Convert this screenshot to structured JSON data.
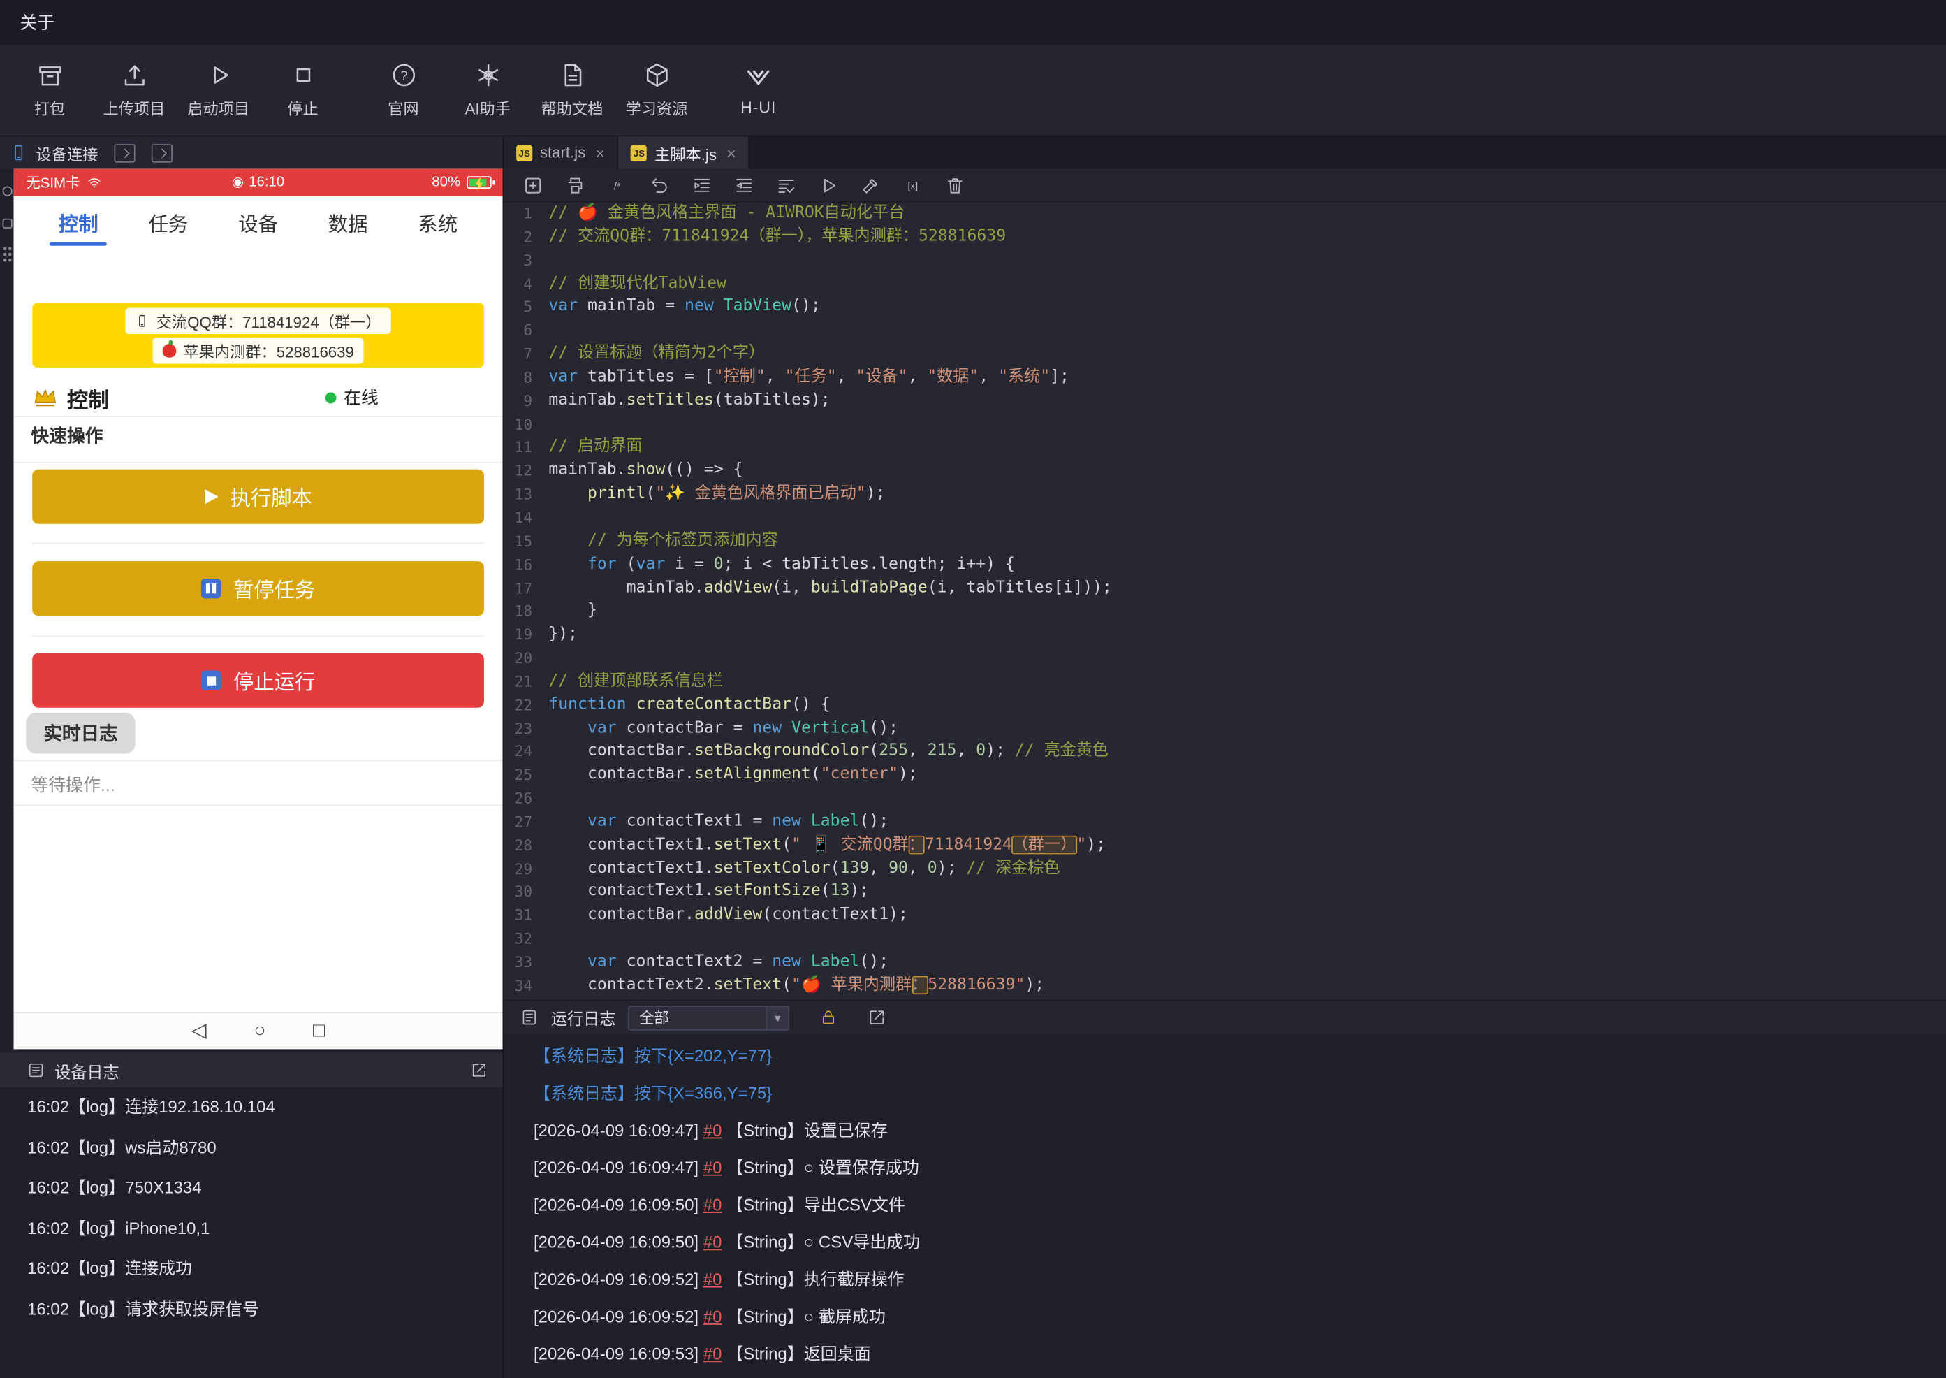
{
  "window": {
    "menu_about": "关于"
  },
  "toolbar": {
    "items": [
      {
        "id": "package",
        "label": "打包"
      },
      {
        "id": "upload",
        "label": "上传项目"
      },
      {
        "id": "play",
        "label": "启动项目"
      },
      {
        "id": "stop",
        "label": "停止"
      },
      {
        "id": "website",
        "label": "官网"
      },
      {
        "id": "ai",
        "label": "AI助手"
      },
      {
        "id": "docs",
        "label": "帮助文档"
      },
      {
        "id": "resources",
        "label": "学习资源"
      }
    ],
    "brand": "H-UI"
  },
  "device_panel": {
    "title": "设备连接",
    "phone": {
      "carrier": "无SIM卡",
      "time": "16:10",
      "battery": "80%",
      "tabs": [
        "控制",
        "任务",
        "设备",
        "数据",
        "系统"
      ],
      "active_tab": "控制",
      "banner_line1": "交流QQ群：711841924（群一）",
      "banner_line2": "苹果内测群：528816639",
      "banner_icons": [
        "phone-icon",
        "apple-icon"
      ],
      "section_icon": "crown-icon",
      "section_title": "控制",
      "online_label": "在线",
      "quick_ops_label": "快速操作",
      "buttons": [
        {
          "id": "run-script",
          "label": "执行脚本",
          "style": "gold",
          "icon": "play"
        },
        {
          "id": "pause-task",
          "label": "暂停任务",
          "style": "gold",
          "icon": "pause"
        },
        {
          "id": "stop-running",
          "label": "停止运行",
          "style": "red",
          "icon": "stop"
        }
      ],
      "live_log_label": "实时日志",
      "waiting_text": "等待操作...",
      "nav_icons": [
        "back-triangle-icon",
        "home-circle-icon",
        "recent-square-icon"
      ]
    },
    "device_log": {
      "title": "设备日志",
      "lines": [
        "16:02【log】连接192.168.10.104",
        "16:02【log】ws启动8780",
        "16:02【log】750X1334",
        "16:02【log】iPhone10,1",
        "16:02【log】连接成功",
        "16:02【log】请求获取投屏信号"
      ]
    }
  },
  "editor": {
    "tabs": [
      {
        "label": "start.js",
        "active": false
      },
      {
        "label": "主脚本.js",
        "active": true
      }
    ],
    "toolbar_icons": [
      "add",
      "print",
      "block-comment",
      "undo",
      "indent",
      "outdent",
      "format-check",
      "run",
      "build",
      "bracket-x",
      "trash"
    ],
    "lines": [
      [
        [
          "cm",
          "// 🍎 金黄色风格主界面 - AIWROK自动化平台"
        ]
      ],
      [
        [
          "cm",
          "// 交流QQ群：711841924（群一），苹果内测群：528816639"
        ]
      ],
      [],
      [
        [
          "cm",
          "// 创建现代化TabView"
        ]
      ],
      [
        [
          "kw",
          "var"
        ],
        [
          "pl",
          " mainTab = "
        ],
        [
          "kw",
          "new"
        ],
        [
          "pl",
          " "
        ],
        [
          "cl",
          "TabView"
        ],
        [
          "pl",
          "();"
        ]
      ],
      [],
      [
        [
          "cm",
          "// 设置标题（精简为2个字）"
        ]
      ],
      [
        [
          "kw",
          "var"
        ],
        [
          "pl",
          " tabTitles = ["
        ],
        [
          "st",
          "\"控制\""
        ],
        [
          "pl",
          ", "
        ],
        [
          "st",
          "\"任务\""
        ],
        [
          "pl",
          ", "
        ],
        [
          "st",
          "\"设备\""
        ],
        [
          "pl",
          ", "
        ],
        [
          "st",
          "\"数据\""
        ],
        [
          "pl",
          ", "
        ],
        [
          "st",
          "\"系统\""
        ],
        [
          "pl",
          "];"
        ]
      ],
      [
        [
          "pl",
          "mainTab."
        ],
        [
          "fn",
          "setTitles"
        ],
        [
          "pl",
          "(tabTitles);"
        ]
      ],
      [],
      [
        [
          "cm",
          "// 启动界面"
        ]
      ],
      [
        [
          "pl",
          "mainTab."
        ],
        [
          "fn",
          "show"
        ],
        [
          "pl",
          "(() => {"
        ]
      ],
      [
        [
          "pl",
          "    "
        ],
        [
          "fn",
          "printl"
        ],
        [
          "pl",
          "("
        ],
        [
          "st",
          "\"✨ 金黄色风格界面已启动\""
        ],
        [
          "pl",
          ");"
        ]
      ],
      [],
      [
        [
          "pl",
          "    "
        ],
        [
          "cm",
          "// 为每个标签页添加内容"
        ]
      ],
      [
        [
          "pl",
          "    "
        ],
        [
          "kw",
          "for"
        ],
        [
          "pl",
          " ("
        ],
        [
          "kw",
          "var"
        ],
        [
          "pl",
          " i = "
        ],
        [
          "nu",
          "0"
        ],
        [
          "pl",
          "; i < tabTitles.length; i++) {"
        ]
      ],
      [
        [
          "pl",
          "        mainTab."
        ],
        [
          "fn",
          "addView"
        ],
        [
          "pl",
          "(i, "
        ],
        [
          "fn",
          "buildTabPage"
        ],
        [
          "pl",
          "(i, tabTitles[i]));"
        ]
      ],
      [
        [
          "pl",
          "    }"
        ]
      ],
      [
        [
          "pl",
          "});"
        ]
      ],
      [],
      [
        [
          "cm",
          "// 创建顶部联系信息栏"
        ]
      ],
      [
        [
          "kw",
          "function"
        ],
        [
          "pl",
          " "
        ],
        [
          "fn",
          "createContactBar"
        ],
        [
          "pl",
          "() {"
        ]
      ],
      [
        [
          "pl",
          "    "
        ],
        [
          "kw",
          "var"
        ],
        [
          "pl",
          " contactBar = "
        ],
        [
          "kw",
          "new"
        ],
        [
          "pl",
          " "
        ],
        [
          "cl",
          "Vertical"
        ],
        [
          "pl",
          "();"
        ]
      ],
      [
        [
          "pl",
          "    contactBar."
        ],
        [
          "fn",
          "setBackgroundColor"
        ],
        [
          "pl",
          "("
        ],
        [
          "nu",
          "255"
        ],
        [
          "pl",
          ", "
        ],
        [
          "nu",
          "215"
        ],
        [
          "pl",
          ", "
        ],
        [
          "nu",
          "0"
        ],
        [
          "pl",
          "); "
        ],
        [
          "cm",
          "// 亮金黄色"
        ]
      ],
      [
        [
          "pl",
          "    contactBar."
        ],
        [
          "fn",
          "setAlignment"
        ],
        [
          "pl",
          "("
        ],
        [
          "st",
          "\"center\""
        ],
        [
          "pl",
          ");"
        ]
      ],
      [],
      [
        [
          "pl",
          "    "
        ],
        [
          "kw",
          "var"
        ],
        [
          "pl",
          " contactText1 = "
        ],
        [
          "kw",
          "new"
        ],
        [
          "pl",
          " "
        ],
        [
          "cl",
          "Label"
        ],
        [
          "pl",
          "();"
        ]
      ],
      [
        [
          "pl",
          "    contactText1."
        ],
        [
          "fn",
          "setText"
        ],
        [
          "pl",
          "("
        ],
        [
          "st",
          "\" 📱 交流QQ群"
        ],
        [
          "hl",
          "："
        ],
        [
          "st",
          "711841924"
        ],
        [
          "hl",
          "（群一）"
        ],
        [
          "st",
          "\""
        ],
        [
          "pl",
          ");"
        ]
      ],
      [
        [
          "pl",
          "    contactText1."
        ],
        [
          "fn",
          "setTextColor"
        ],
        [
          "pl",
          "("
        ],
        [
          "nu",
          "139"
        ],
        [
          "pl",
          ", "
        ],
        [
          "nu",
          "90"
        ],
        [
          "pl",
          ", "
        ],
        [
          "nu",
          "0"
        ],
        [
          "pl",
          "); "
        ],
        [
          "cm",
          "// 深金棕色"
        ]
      ],
      [
        [
          "pl",
          "    contactText1."
        ],
        [
          "fn",
          "setFontSize"
        ],
        [
          "pl",
          "("
        ],
        [
          "nu",
          "13"
        ],
        [
          "pl",
          ");"
        ]
      ],
      [
        [
          "pl",
          "    contactBar."
        ],
        [
          "fn",
          "addView"
        ],
        [
          "pl",
          "(contactText1);"
        ]
      ],
      [],
      [
        [
          "pl",
          "    "
        ],
        [
          "kw",
          "var"
        ],
        [
          "pl",
          " contactText2 = "
        ],
        [
          "kw",
          "new"
        ],
        [
          "pl",
          " "
        ],
        [
          "cl",
          "Label"
        ],
        [
          "pl",
          "();"
        ]
      ],
      [
        [
          "pl",
          "    contactText2."
        ],
        [
          "fn",
          "setText"
        ],
        [
          "pl",
          "("
        ],
        [
          "st",
          "\"🍎 苹果内测群"
        ],
        [
          "hl",
          "："
        ],
        [
          "st",
          "528816639\""
        ],
        [
          "pl",
          ");"
        ]
      ]
    ]
  },
  "run_log": {
    "title": "运行日志",
    "filter_value": "全部",
    "entries": [
      {
        "kind": "system",
        "text": "【系统日志】按下{X=202,Y=77}"
      },
      {
        "kind": "system",
        "text": "【系统日志】按下{X=366,Y=75}"
      },
      {
        "kind": "log",
        "time": "[2026-04-09 16:09:47]",
        "tag": "#0",
        "type": "【String】",
        "text": "设置已保存"
      },
      {
        "kind": "log",
        "time": "[2026-04-09 16:09:47]",
        "tag": "#0",
        "type": "【String】",
        "text": "○ 设置保存成功"
      },
      {
        "kind": "log",
        "time": "[2026-04-09 16:09:50]",
        "tag": "#0",
        "type": "【String】",
        "text": "导出CSV文件"
      },
      {
        "kind": "log",
        "time": "[2026-04-09 16:09:50]",
        "tag": "#0",
        "type": "【String】",
        "text": "○ CSV导出成功"
      },
      {
        "kind": "log",
        "time": "[2026-04-09 16:09:52]",
        "tag": "#0",
        "type": "【String】",
        "text": "执行截屏操作"
      },
      {
        "kind": "log",
        "time": "[2026-04-09 16:09:52]",
        "tag": "#0",
        "type": "【String】",
        "text": "○ 截屏成功"
      },
      {
        "kind": "log",
        "time": "[2026-04-09 16:09:53]",
        "tag": "#0",
        "type": "【String】",
        "text": "返回桌面"
      }
    ]
  },
  "colors": {
    "gold_banner": "#FFD700",
    "gold_button": "#D9A50E",
    "red": "#E23C3C",
    "blue_accent": "#3A6FD8",
    "online_green": "#21BA45"
  }
}
